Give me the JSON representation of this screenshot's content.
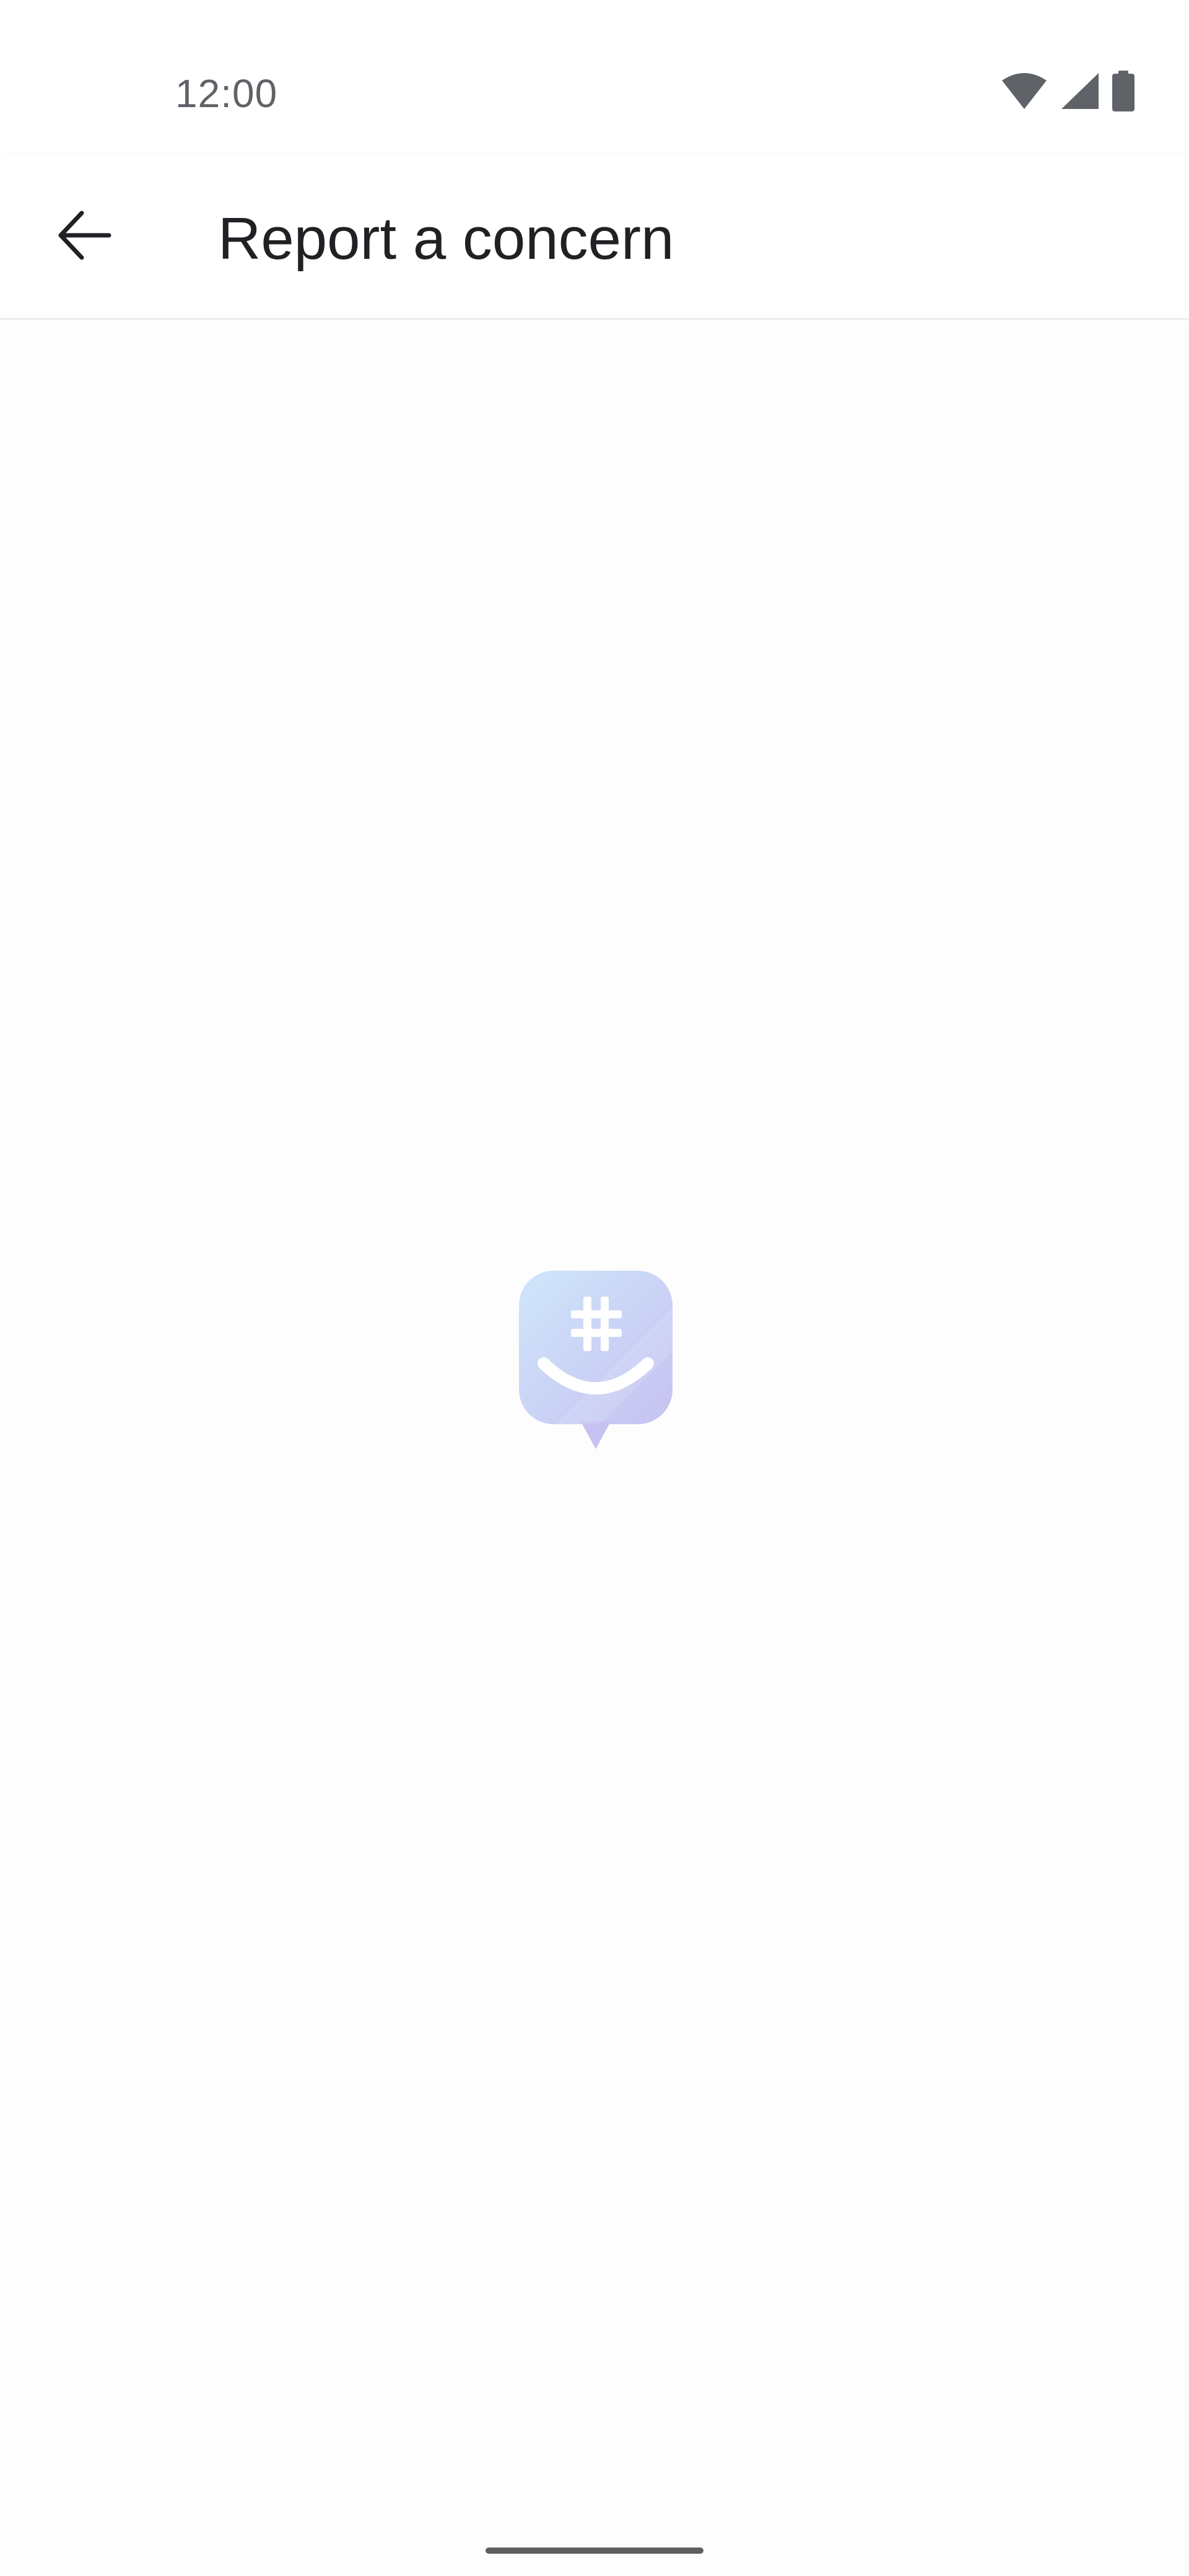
{
  "status_bar": {
    "time": "12:00",
    "icons": [
      "wifi-icon",
      "cellular-signal-icon",
      "battery-icon"
    ]
  },
  "app_bar": {
    "back_icon": "arrow-left-icon",
    "title": "Report a concern"
  },
  "content": {
    "loading_logo": "chat-bubble-hashtag-smile-logo"
  },
  "colors": {
    "logo_gradient_start": "#cfe6fb",
    "logo_gradient_end": "#c9c6f2",
    "title_text": "#202124",
    "status_text": "#5f6368"
  }
}
